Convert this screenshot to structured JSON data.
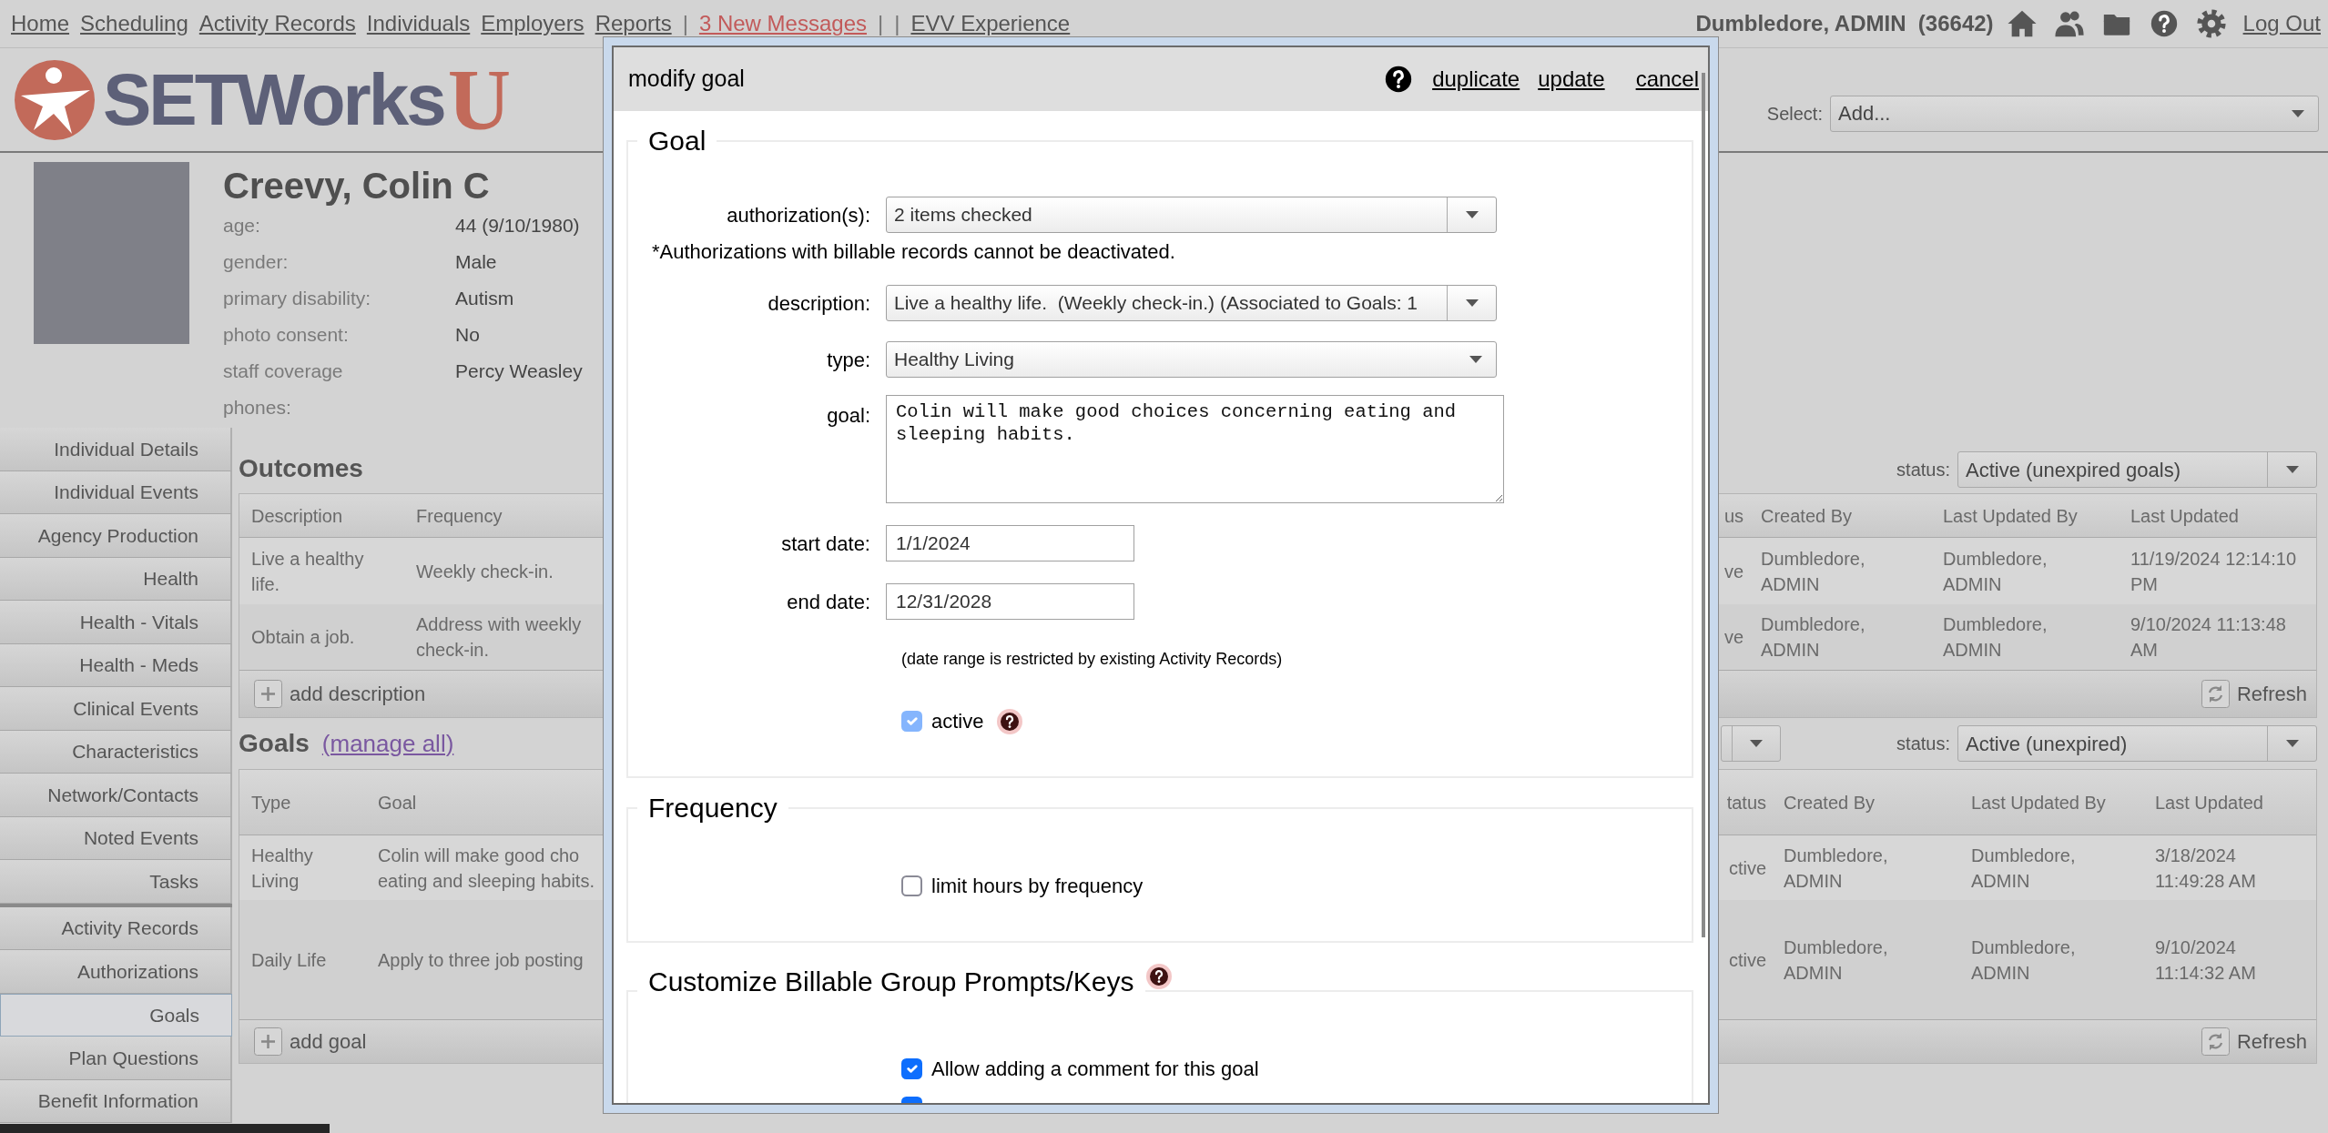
{
  "top_nav": {
    "items": [
      {
        "kind": "link",
        "text": "Home"
      },
      {
        "kind": "link",
        "text": "Scheduling"
      },
      {
        "kind": "link",
        "text": "Activity Records"
      },
      {
        "kind": "link",
        "text": "Individuals"
      },
      {
        "kind": "link",
        "text": "Employers"
      },
      {
        "kind": "link",
        "text": "Reports"
      },
      {
        "kind": "separator",
        "text": "|"
      },
      {
        "kind": "alert",
        "text": "3 New Messages"
      },
      {
        "kind": "separator",
        "text": "|"
      },
      {
        "kind": "separator",
        "text": "|"
      },
      {
        "kind": "link",
        "text": "EVV Experience"
      }
    ],
    "user": "Dumbledore, ADMIN  (36642)",
    "logout": "Log Out"
  },
  "logo": {
    "name": "SETWorks",
    "mark": "U"
  },
  "add_select": {
    "label": "Select:",
    "value": "Add..."
  },
  "individual": {
    "name": "Creevy, Colin C",
    "fields": [
      {
        "label": "age:",
        "value": "44 (9/10/1980)"
      },
      {
        "label": "gender:",
        "value": "Male"
      },
      {
        "label": "primary disability:",
        "value": "Autism"
      },
      {
        "label": "photo consent:",
        "value": "No"
      },
      {
        "label": "staff coverage",
        "value": "Percy Weasley"
      },
      {
        "label": "phones:"
      }
    ]
  },
  "sidebar": {
    "groups": [
      [
        {
          "label": "Individual Details",
          "selected": false
        },
        {
          "label": "Individual Events",
          "selected": false
        },
        {
          "label": "Agency Production",
          "selected": false
        },
        {
          "label": "Health",
          "selected": false
        },
        {
          "label": "Health - Vitals",
          "selected": false
        },
        {
          "label": "Health - Meds",
          "selected": false
        },
        {
          "label": "Clinical Events",
          "selected": false
        },
        {
          "label": "Characteristics",
          "selected": false
        },
        {
          "label": "Network/Contacts",
          "selected": false
        },
        {
          "label": "Noted Events",
          "selected": false
        },
        {
          "label": "Tasks",
          "selected": false
        }
      ],
      [
        {
          "label": "Activity Records",
          "selected": false
        },
        {
          "label": "Authorizations",
          "selected": false
        },
        {
          "label": "Goals",
          "selected": true
        },
        {
          "label": "Plan Questions",
          "selected": false
        },
        {
          "label": "Benefit Information",
          "selected": false
        }
      ]
    ]
  },
  "outcomes": {
    "title": "Outcomes",
    "status": {
      "label": "status:",
      "value": "Active (unexpired goals)"
    },
    "columns": [
      "Description",
      "Frequency",
      "us",
      "Created By",
      "Last Updated By",
      "Last Updated"
    ],
    "rows": [
      [
        "Live a healthy\nlife.",
        "Weekly check-in.",
        "ve",
        "Dumbledore,\nADMIN",
        "Dumbledore,\nADMIN",
        "11/19/2024 12:14:10\nPM"
      ],
      [
        "Obtain a job.",
        "Address with weekly\ncheck-in.",
        "ve",
        "Dumbledore,\nADMIN",
        "Dumbledore,\nADMIN",
        "9/10/2024 11:13:48\nAM"
      ]
    ],
    "add": "add description",
    "refresh": "Refresh"
  },
  "goals": {
    "title": "Goals",
    "link": "(manage all)",
    "status": {
      "label": "status:",
      "value": "Active (unexpired)"
    },
    "columns": [
      "Type",
      "Goal",
      "tatus",
      "Created By",
      "Last Updated By",
      "Last Updated"
    ],
    "rows": [
      [
        "Healthy\nLiving",
        "Colin will make good cho\neating and sleeping habits.",
        "ctive",
        "Dumbledore,\nADMIN",
        "Dumbledore,\nADMIN",
        "3/18/2024\n11:49:28 AM"
      ],
      [
        "Daily Life",
        "Apply to three job posting",
        "ctive",
        "Dumbledore,\nADMIN",
        "Dumbledore,\nADMIN",
        "9/10/2024\n11:14:32 AM"
      ]
    ],
    "add": "add goal",
    "refresh": "Refresh"
  },
  "modal": {
    "title": "modify goal",
    "actions": [
      "duplicate",
      "update",
      "cancel"
    ],
    "sections": [
      {
        "legend": "Goal",
        "rows": [
          {
            "kind": "combo",
            "label": "authorization(s):",
            "value": "2 items checked"
          },
          {
            "kind": "note",
            "text": "*Authorizations with billable records cannot be deactivated."
          },
          {
            "kind": "combo",
            "label": "description:",
            "value": "Live a healthy life.  (Weekly check-in.) (Associated to Goals: 1"
          },
          {
            "kind": "select",
            "label": "type:",
            "value": "Healthy Living"
          },
          {
            "kind": "textarea",
            "label": "goal:",
            "value": "Colin will make good choices concerning eating and sleeping habits."
          },
          {
            "kind": "input",
            "label": "start date:",
            "value": "1/1/2024"
          },
          {
            "kind": "input",
            "label": "end date:",
            "value": "12/31/2028"
          },
          {
            "kind": "hint",
            "text": "(date range is restricted by existing Activity Records)"
          },
          {
            "kind": "checkbox",
            "label": "active",
            "checked": true,
            "disabled": true,
            "help": true
          }
        ]
      },
      {
        "legend": "Frequency",
        "rows": [
          {
            "kind": "checkbox",
            "label": "limit hours by frequency",
            "checked": false,
            "disabled": false
          }
        ]
      },
      {
        "legend": "Customize Billable Group Prompts/Keys",
        "help": true,
        "rows": [
          {
            "kind": "checkbox",
            "label": "Allow adding a comment for this goal",
            "checked": true,
            "disabled": false
          },
          {
            "kind": "checkbox",
            "checked": true,
            "disabled": false
          }
        ]
      }
    ]
  }
}
